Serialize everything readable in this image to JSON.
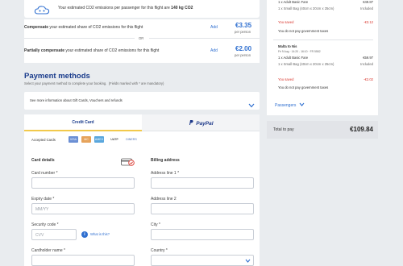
{
  "co2": {
    "banner_prefix": "Your estimated CO2 emissions per passenger for this flight are",
    "banner_value": "140 kg CO2",
    "compensate": {
      "bold": "Compensate",
      "rest": "your estimated share of CO2 emissions for this flight",
      "add": "Add",
      "price": "€3.35",
      "per": "per person"
    },
    "or": "OR",
    "partial": {
      "bold": "Partially compensate",
      "rest": "your estimated share of CO2 emissions for this flight",
      "add": "Add",
      "price": "€2.00",
      "per": "per person"
    }
  },
  "payment": {
    "title": "Payment methods",
    "subtitle": "Select your payment method to complete your booking.",
    "mandatory": "(Fields marked with * are mandatory)",
    "gift_info": "See more information about Gift Cards, Vouchers and refunds",
    "tabs": {
      "credit": "Credit Card",
      "paypal": "PayPal"
    },
    "accepted": "Accepted Cards",
    "card_logos": [
      "VISA",
      "MC",
      "AMEX",
      "UATP",
      "DINERS"
    ],
    "card_details": "Card details",
    "billing": "Billing address",
    "card_number_label": "Card number *",
    "expiry_label": "Expiry date *",
    "expiry_placeholder": "MM/YY",
    "cvv_label": "Security code *",
    "cvv_placeholder": "CVV",
    "whats_this": "What is this?",
    "holder_label": "Cardholder name *",
    "addr1_label": "Address line 1 *",
    "addr2_label": "Address line 2",
    "city_label": "City *",
    "country_label": "Country *"
  },
  "summary": {
    "top": {
      "fare": "1 x Adult Basic Fare",
      "fare_price": "€49.87",
      "bag": "1 x Small Bag (40cm x 20cm x 25cm)",
      "bag_price": "Included",
      "saved": "You saved",
      "saved_amount": "-€3.12",
      "tax_note": "You do not pay government taxes"
    },
    "route2": {
      "route": "Malta to Nis",
      "date_line": "Fri 9 Aug · 14:20 - 16:10 · FR 5582",
      "fare": "1 x Adult Basic Fare",
      "fare_price": "€59.97",
      "bag": "1 x Small Bag (40cm x 20cm x 25cm)",
      "bag_price": "Included",
      "saved": "You saved",
      "saved_amount": "-€2.02",
      "tax_note": "You do not pay government taxes"
    },
    "passengers": "Passengers",
    "total_label": "Total to pay",
    "total_value": "€109.84"
  },
  "colors": {
    "brand": "#2f6fd0",
    "title": "#1a3c8c",
    "saved": "#d9342b",
    "total_bg": "#e2e4e8"
  }
}
